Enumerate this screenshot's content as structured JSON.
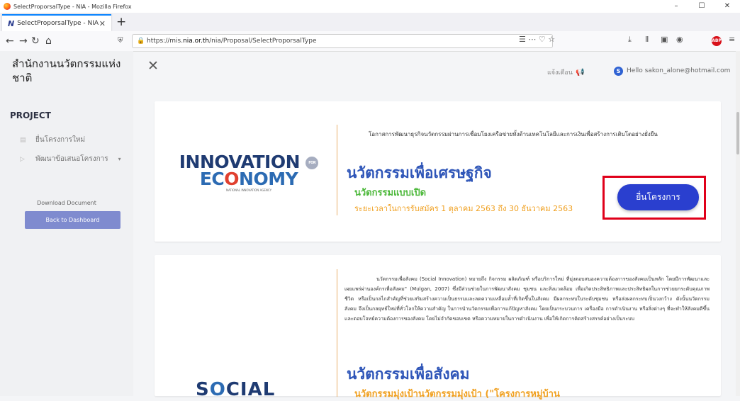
{
  "window": {
    "title": "SelectProporsalType - NIA - Mozilla Firefox",
    "controls": [
      "–",
      "☐",
      "✕"
    ]
  },
  "tab": {
    "logo": "N",
    "title": "SelectProporsalType - NIA",
    "close": "✕",
    "new": "+"
  },
  "nav": {
    "back": "←",
    "forward": "→",
    "reload": "↻",
    "home": "⌂",
    "url_prefix": "https://mis.",
    "url_domain": "nia.or.th",
    "url_path": "/nia/Proposal/SelectProporsalType",
    "url_actions": "☰ ⋯ ♡ ☆"
  },
  "sidebar": {
    "org_name": "สำนักงานนวัตกรรมแห่งชาติ",
    "section": "PROJECT",
    "items": [
      {
        "label": "ยื่นโครงการใหม่"
      },
      {
        "label": "พัฒนาข้อเสนอโครงการ",
        "dropdown": "▾"
      }
    ],
    "download": "Download Document",
    "dashboard": "Back to Dashboard"
  },
  "header": {
    "close": "✕",
    "notify": "แจ้งเตือน",
    "user_initial": "S",
    "hello": "Hello sakon_alone@hotmail.com"
  },
  "card_economy": {
    "logo_line1": "INNOVATION",
    "logo_for": "FOR",
    "logo_line2_a": "EC",
    "logo_line2_o": "O",
    "logo_line2_b": "NOMY",
    "logo_agency": "NATIONAL INNOVATION AGENCY",
    "description": "โอกาสการพัฒนาธุรกิจนวัตกรรมผ่านการเชื่อมโยงเครือข่ายทั้งด้านเทคโนโลยีและการเงินเพื่อสร้างการเติบโตอย่างยั่งยืน",
    "title": "นวัตกรรมเพื่อเศรษฐกิจ",
    "subtitle": "นวัตกรรมแบบเปิด",
    "period": "ระยะเวลาในการรับสมัคร 1 ตุลาคม 2563 ถึง 30 ธันวาคม 2563",
    "button": "ยื่นโครงการ"
  },
  "card_social": {
    "logo_a": "S",
    "logo_o": "O",
    "logo_b": "CIAL",
    "description": "นวัตกรรมเพื่อสังคม (Social Innovation) หมายถึง กิจกรรม ผลิตภัณฑ์ หรือบริการใหม่ ที่มุ่งตอบสนองความต้องการของสังคมเป็นหลัก โดยมีการพัฒนาและเผยแพร่ผ่านองค์กรเพื่อสังคม\" (Mulgan, 2007) ซึ่งมีส่วนช่วยในการพัฒนาสังคม ชุมชน และสิ่งแวดล้อม เพื่อเกิดประสิทธิภาพและประสิทธิผลในการช่วยยกระดับคุณภาพชีวิต หรือเป็นกลไกสำคัญที่ช่วยเสริมสร้างความเป็นธรรมและลดความเหลื่อมล้ำที่เกิดขึ้นในสังคม มีผลกระทบในระดับชุมชน หรือส่งผลกระทบเป็นวงกว้าง ดังนั้นนวัตกรรมสังคม จึงเป็นกลยุทธ์ใหม่ที่ทั่วโลกให้ความสำคัญ ในการนำนวัตกรรมเพื่อการแก้ปัญหาสังคม โดยเป็นกระบวนการ เครื่องมือ การดำเนินงาน หรือสิ่งต่างๆ ที่จะทำให้สังคมดีขึ้น และตอบโจทย์ความต้องการของสังคม โดยไม่จำกัดขอบเขต หรือความหมายในการดำเนินงาน เพื่อให้เกิดการคิดสร้างสรรค์อย่างเป็นระบบ",
    "title": "นวัตกรรมเพื่อสังคม",
    "subtitle": "นวัตกรรมมุ่งเป้านวัตกรรมมุ่งเป้า (\"โครงการหมู่บ้าน"
  },
  "colors": {
    "accent": "#2a3fcf",
    "title_blue": "#2e55b8",
    "green": "#4cb83a",
    "orange": "#f0a020",
    "highlight": "#e0001a"
  }
}
